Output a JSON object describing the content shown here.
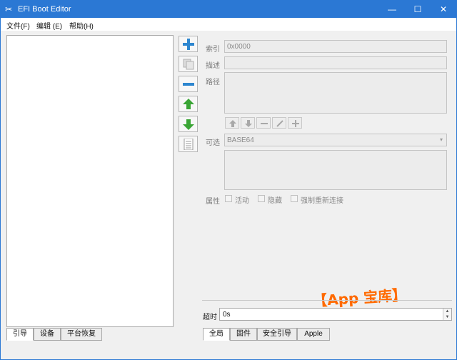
{
  "window": {
    "title": "EFI Boot Editor",
    "minimize": "—",
    "maximize": "☐",
    "close": "✕"
  },
  "menubar": {
    "items": [
      "文件(F)",
      "编辑 (E)",
      "帮助(H)"
    ]
  },
  "left_tabs": {
    "items": [
      "引导",
      "设备",
      "平台恢复"
    ],
    "active": "引导"
  },
  "side_buttons": [
    "add-icon",
    "copy-icon",
    "remove-icon",
    "move-up-icon",
    "move-down-icon",
    "document-icon"
  ],
  "form": {
    "index_label": "索引",
    "index_value": "0x0000",
    "desc_label": "描述",
    "desc_value": "",
    "path_label": "路径",
    "path_value": "",
    "optional_label": "可选",
    "optional_value": "BASE64",
    "attributes_label": "属性",
    "attr_active": "活动",
    "attr_hidden": "隐藏",
    "attr_force_reconnect": "强制重新连接"
  },
  "path_buttons": [
    "arrow-up-icon",
    "arrow-down-icon",
    "minus-icon",
    "edit-icon",
    "plus-icon"
  ],
  "timeout": {
    "label": "超时",
    "value": "0s"
  },
  "bottom_tabs": {
    "items": [
      "全局",
      "固件",
      "安全引导",
      "Apple"
    ],
    "active": "全局"
  },
  "watermark": "【App 宝库】",
  "colors": {
    "titlebar": "#2b78d4",
    "accent_green": "#3aa535",
    "accent_blue": "#2d86cf",
    "watermark": "#ff6a00"
  }
}
